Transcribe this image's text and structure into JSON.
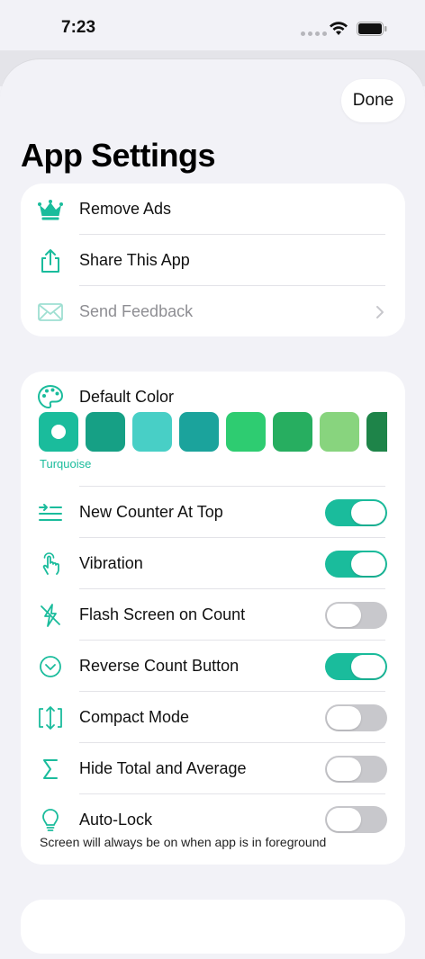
{
  "status_bar": {
    "time": "7:23"
  },
  "header": {
    "done_label": "Done",
    "title": "App Settings"
  },
  "colors": {
    "accent": "#1abc9c",
    "toggle_off": "#c8c8cc"
  },
  "section_general": {
    "items": [
      {
        "label": "Remove Ads",
        "icon": "crown-icon"
      },
      {
        "label": "Share This App",
        "icon": "share-icon"
      },
      {
        "label": "Send Feedback",
        "icon": "envelope-icon",
        "disabled": true
      }
    ]
  },
  "section_preferences": {
    "default_color": {
      "label": "Default Color",
      "icon": "palette-icon",
      "selected_name": "Turquoise",
      "swatches": [
        "#1abc9c",
        "#16a085",
        "#48cfc6",
        "#1ba39c",
        "#2ecc71",
        "#27ae60",
        "#88d47e",
        "#1e8449"
      ]
    },
    "toggles": [
      {
        "label": "New Counter At Top",
        "icon": "list-insert-icon",
        "on": true
      },
      {
        "label": "Vibration",
        "icon": "hand-tap-icon",
        "on": true
      },
      {
        "label": "Flash Screen on Count",
        "icon": "flash-off-icon",
        "on": false
      },
      {
        "label": "Reverse Count Button",
        "icon": "chevron-circle-down-icon",
        "on": true
      },
      {
        "label": "Compact Mode",
        "icon": "compress-icon",
        "on": false
      },
      {
        "label": "Hide Total and Average",
        "icon": "sigma-icon",
        "on": false
      },
      {
        "label": "Auto-Lock",
        "icon": "lightbulb-icon",
        "on": false
      }
    ],
    "auto_lock_note": "Screen will always be on when app is in foreground"
  }
}
